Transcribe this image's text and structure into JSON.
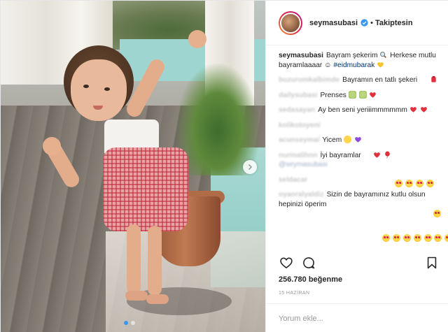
{
  "header": {
    "username": "seymasubasi",
    "separator": "•",
    "follow_state": "Takiptesin"
  },
  "caption": {
    "username": "seymasubasi",
    "text_1": "Bayram şekerim",
    "text_2": "Herkese mutlu bayramlaaaar",
    "text_3": "☺",
    "hashtag": "#eidmubarak"
  },
  "comments": [
    {
      "username": "buzurumkalbimde",
      "text": "Bayramın en tatlı şekeri"
    },
    {
      "username": "",
      "text": ""
    },
    {
      "username": "dailysubasi",
      "text": "Prenses"
    },
    {
      "username": "sedasayan",
      "text": "Ay ben seni yeriiimmmmmm"
    },
    {
      "username": "kolikotoyeni",
      "text": ""
    },
    {
      "username": "acunseymai",
      "text": "Yicem"
    },
    {
      "username": "nurinalihnn",
      "text": "İyi bayramlar",
      "mention": "@seymasubasi"
    },
    {
      "username": "seldacar",
      "text": ""
    },
    {
      "username": "oyaoralyaldiz",
      "text": "Sizin de bayramınız kutlu olsun hepinizi öperim"
    }
  ],
  "stats": {
    "likes": "256.780 beğenme",
    "date": "15 HAZİRAN"
  },
  "composer": {
    "placeholder": "Yorum ekle..."
  },
  "icons": [
    "verified-icon",
    "heart-icon",
    "comment-icon",
    "bookmark-icon",
    "chevron-right-icon"
  ],
  "colors": {
    "link": "#003569",
    "active_dot": "#3897f0",
    "verified": "#3897f0"
  }
}
